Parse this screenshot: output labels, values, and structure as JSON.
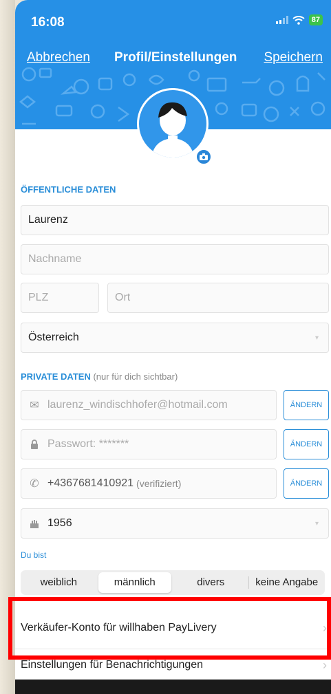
{
  "status": {
    "time": "16:08",
    "battery": "87"
  },
  "nav": {
    "cancel": "Abbrechen",
    "title": "Profil/Einstellungen",
    "save": "Speichern"
  },
  "public_section": {
    "title": "ÖFFENTLICHE DATEN"
  },
  "fields": {
    "firstname": "Laurenz",
    "lastname_placeholder": "Nachname",
    "zip_placeholder": "PLZ",
    "city_placeholder": "Ort",
    "country": "Österreich"
  },
  "private_section": {
    "title": "PRIVATE DATEN",
    "note": "(nur für dich sichtbar)"
  },
  "private": {
    "email": "laurenz_windischhofer@hotmail.com",
    "password": "Passwort: *******",
    "phone": "+4367681410921",
    "phone_status": "(verifiziert)",
    "year": "1956",
    "change_label": "ÄNDERN"
  },
  "gender": {
    "label": "Du bist",
    "options": [
      "weiblich",
      "männlich",
      "divers",
      "keine Angabe"
    ],
    "selected": "männlich"
  },
  "rows": {
    "seller": "Verkäufer-Konto für willhaben PayLivery",
    "notifications": "Einstellungen für Benachrichtigungen"
  },
  "colors": {
    "accent": "#2690e6",
    "highlight": "#ff0000"
  }
}
